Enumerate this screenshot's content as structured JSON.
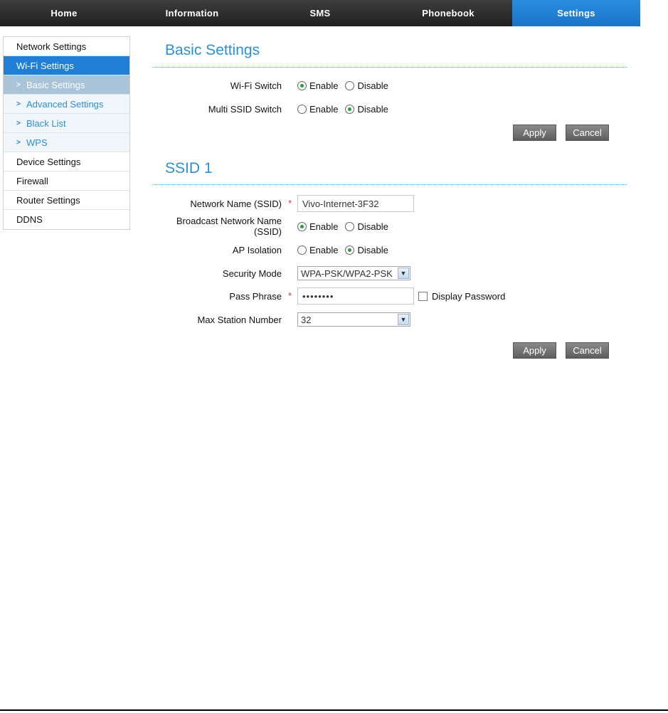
{
  "topnav": {
    "tabs": [
      "Home",
      "Information",
      "SMS",
      "Phonebook",
      "Settings"
    ],
    "active": "Settings"
  },
  "sidebar": {
    "network_settings": "Network Settings",
    "wifi_settings": "Wi-Fi Settings",
    "sub": [
      "Basic Settings",
      "Advanced Settings",
      "Black List",
      "WPS"
    ],
    "device_settings": "Device Settings",
    "firewall": "Firewall",
    "router_settings": "Router Settings",
    "ddns": "DDNS"
  },
  "basic": {
    "title": "Basic Settings",
    "wifi_switch": {
      "label": "Wi-Fi Switch",
      "enable": "Enable",
      "disable": "Disable",
      "selected": "Enable"
    },
    "multi_ssid": {
      "label": "Multi SSID Switch",
      "enable": "Enable",
      "disable": "Disable",
      "selected": "Disable"
    },
    "apply": "Apply",
    "cancel": "Cancel"
  },
  "ssid1": {
    "title": "SSID 1",
    "network_name": {
      "label": "Network Name (SSID)",
      "required": "*",
      "value": "Vivo-Internet-3F32"
    },
    "broadcast": {
      "label": "Broadcast Network Name (SSID)",
      "enable": "Enable",
      "disable": "Disable",
      "selected": "Enable"
    },
    "ap_isolation": {
      "label": "AP Isolation",
      "enable": "Enable",
      "disable": "Disable",
      "selected": "Disable"
    },
    "security_mode": {
      "label": "Security Mode",
      "value": "WPA-PSK/WPA2-PSK"
    },
    "pass_phrase": {
      "label": "Pass Phrase",
      "required": "*",
      "value": "••••••••",
      "display_password": "Display Password"
    },
    "max_station": {
      "label": "Max Station Number",
      "value": "32"
    },
    "apply": "Apply",
    "cancel": "Cancel"
  },
  "colors": {
    "accent": "#2d8fd8",
    "active_tab": "#1f7fd6",
    "nav_bg": "#2a2a2a",
    "radio_on": "#2a9a3a"
  },
  "icons": {
    "chevron": "chevron-right-icon",
    "select_arrow": "chevron-down-icon"
  }
}
